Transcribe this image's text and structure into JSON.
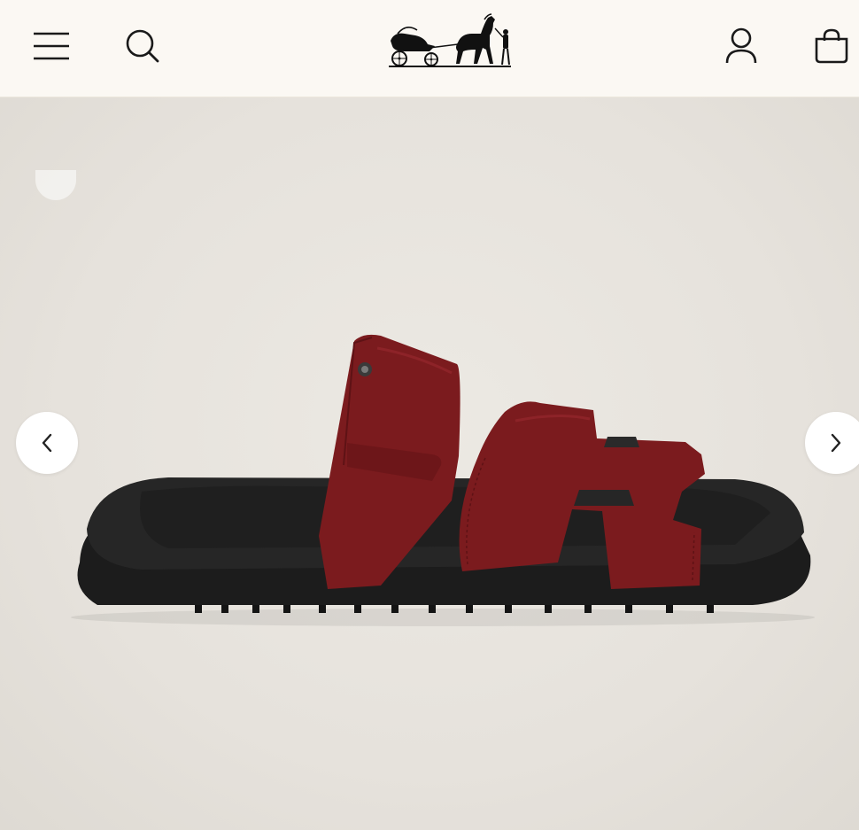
{
  "header": {
    "menu_icon": "hamburger-menu-icon",
    "search_icon": "search-icon",
    "logo": "horse-carriage-logo",
    "account_icon": "user-icon",
    "bag_icon": "shopping-bag-icon",
    "background_color": "#fbf8f3"
  },
  "gallery": {
    "product_image": "red-leather-sandal",
    "strap_color": "#7b1b1e",
    "sole_color": "#1e1e1e",
    "background_color": "#e9e6e0",
    "prev_icon": "chevron-left-icon",
    "next_icon": "chevron-right-icon"
  }
}
